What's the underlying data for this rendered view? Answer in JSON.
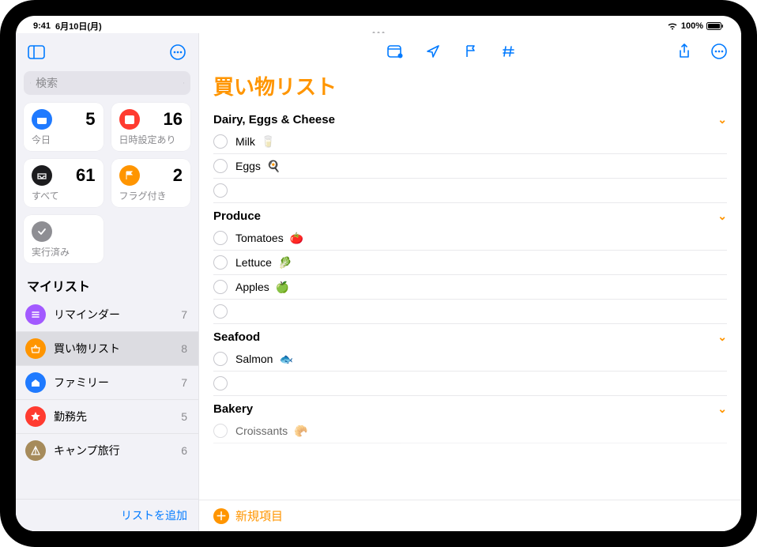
{
  "status": {
    "time": "9:41",
    "date": "6月10日(月)",
    "battery": "100%"
  },
  "sidebar": {
    "search_placeholder": "検索",
    "cards": {
      "today": {
        "label": "今日",
        "count": "5"
      },
      "scheduled": {
        "label": "日時設定あり",
        "count": "16"
      },
      "all": {
        "label": "すべて",
        "count": "61"
      },
      "flagged": {
        "label": "フラグ付き",
        "count": "2"
      },
      "completed": {
        "label": "実行済み"
      }
    },
    "my_lists_title": "マイリスト",
    "lists": [
      {
        "label": "リマインダー",
        "count": "7"
      },
      {
        "label": "買い物リスト",
        "count": "8"
      },
      {
        "label": "ファミリー",
        "count": "7"
      },
      {
        "label": "勤務先",
        "count": "5"
      },
      {
        "label": "キャンプ旅行",
        "count": "6"
      }
    ],
    "add_list": "リストを追加"
  },
  "main": {
    "title": "買い物リスト",
    "sections": [
      {
        "title": "Dairy, Eggs & Cheese",
        "items": [
          {
            "text": "Milk",
            "emoji": "🥛"
          },
          {
            "text": "Eggs",
            "emoji": "🍳"
          }
        ]
      },
      {
        "title": "Produce",
        "items": [
          {
            "text": "Tomatoes",
            "emoji": "🍅"
          },
          {
            "text": "Lettuce",
            "emoji": "🥬"
          },
          {
            "text": "Apples",
            "emoji": "🍏"
          }
        ]
      },
      {
        "title": "Seafood",
        "items": [
          {
            "text": "Salmon",
            "emoji": "🐟"
          }
        ]
      },
      {
        "title": "Bakery",
        "items": [
          {
            "text": "Croissants",
            "emoji": "🥐"
          }
        ]
      }
    ],
    "new_item": "新規項目"
  }
}
